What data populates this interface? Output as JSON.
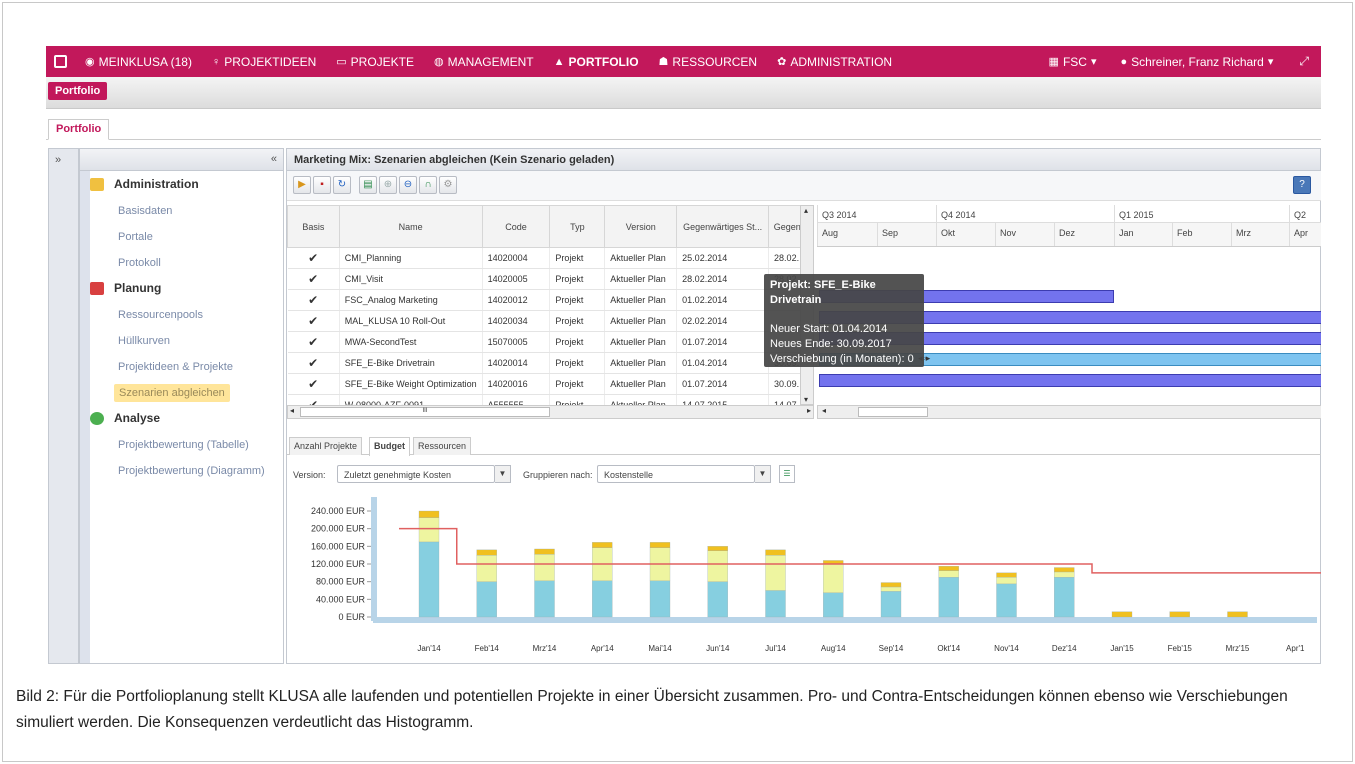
{
  "nav": {
    "items": [
      {
        "icon": "home-icon",
        "glyph": "◉",
        "label": "MEINKLUSA (18)"
      },
      {
        "icon": "lightbulb-icon",
        "glyph": "♀",
        "label": "PROJEKTIDEEN"
      },
      {
        "icon": "calendar-icon",
        "glyph": "▭",
        "label": "PROJEKTE"
      },
      {
        "icon": "globe-icon",
        "glyph": "◍",
        "label": "MANAGEMENT"
      },
      {
        "icon": "portfolio-icon",
        "glyph": "▲",
        "label": "PORTFOLIO",
        "active": true
      },
      {
        "icon": "people-icon",
        "glyph": "☗",
        "label": "RESSOURCEN"
      },
      {
        "icon": "gear-icon",
        "glyph": "✿",
        "label": "ADMINISTRATION"
      }
    ],
    "org": "FSC",
    "user": "Schreiner, Franz Richard",
    "color": "#c2185b"
  },
  "breadcrumb": "Portfolio",
  "tab": "Portfolio",
  "sidebar": {
    "sections": [
      {
        "label": "Administration",
        "color": "#f0c040",
        "items": [
          "Basisdaten",
          "Portale",
          "Protokoll"
        ]
      },
      {
        "label": "Planung",
        "color": "#d84040",
        "items": [
          "Ressourcenpools",
          "Hüllkurven",
          "Projektideen & Projekte",
          "Szenarien abgleichen"
        ]
      },
      {
        "label": "Analyse",
        "color": "#4caf50",
        "items": [
          "Projektbewertung (Tabelle)",
          "Projektbewertung (Diagramm)"
        ]
      }
    ],
    "selected": "Szenarien abgleichen"
  },
  "main": {
    "title": "Marketing Mix: Szenarien abgleichen (Kein Szenario geladen)",
    "grid": {
      "headers": [
        "Basis",
        "Name",
        "Code",
        "Typ",
        "Version",
        "Gegenwärtiges St...",
        "Gegenw"
      ],
      "rows": [
        [
          "✔",
          "CMI_Planning",
          "14020004",
          "Projekt",
          "Aktueller Plan",
          "25.02.2014",
          "28.02."
        ],
        [
          "✔",
          "CMI_Visit",
          "14020005",
          "Projekt",
          "Aktueller Plan",
          "28.02.2014",
          "28.02."
        ],
        [
          "✔",
          "FSC_Analog Marketing",
          "14020012",
          "Projekt",
          "Aktueller Plan",
          "01.02.2014",
          ""
        ],
        [
          "✔",
          "MAL_KLUSA 10 Roll-Out",
          "14020034",
          "Projekt",
          "Aktueller Plan",
          "02.02.2014",
          ""
        ],
        [
          "✔",
          "MWA-SecondTest",
          "15070005",
          "Projekt",
          "Aktueller Plan",
          "01.07.2014",
          ""
        ],
        [
          "✔",
          "SFE_E-Bike Drivetrain",
          "14020014",
          "Projekt",
          "Aktueller Plan",
          "01.04.2014",
          "30.09."
        ],
        [
          "✔",
          "SFE_E-Bike Weight Optimization",
          "14020016",
          "Projekt",
          "Aktueller Plan",
          "01.07.2014",
          "30.09."
        ],
        [
          "✔",
          "W-08000-AZF-0091",
          "A555555",
          "Projekt",
          "Aktueller Plan",
          "14.07.2015",
          "14.07."
        ]
      ],
      "scroll_marker": "III"
    },
    "gantt": {
      "quarters": [
        "Q3 2014",
        "Q4 2014",
        "Q1 2015",
        "Q2"
      ],
      "months": [
        "Aug",
        "Sep",
        "Okt",
        "Nov",
        "Dez",
        "Jan",
        "Feb",
        "Mrz",
        "Apr"
      ]
    },
    "tooltip": {
      "title": "Projekt: SFE_E-Bike Drivetrain",
      "start": "Neuer Start: 01.04.2014",
      "end": "Neues Ende: 30.09.2017",
      "shift": "Verschiebung (in Monaten): 0"
    },
    "bottom_tabs": [
      "Anzahl Projekte",
      "Budget",
      "Ressourcen"
    ],
    "active_bottom_tab": "Budget",
    "filters": {
      "version_label": "Version:",
      "version_value": "Zuletzt genehmigte Kosten",
      "group_label": "Gruppieren nach:",
      "group_value": "Kostenstelle"
    }
  },
  "chart_data": {
    "type": "bar",
    "stacked": true,
    "categories": [
      "Jan'14",
      "Feb'14",
      "Mrz'14",
      "Apr'14",
      "Mai'14",
      "Jun'14",
      "Jul'14",
      "Aug'14",
      "Sep'14",
      "Okt'14",
      "Nov'14",
      "Dez'14",
      "Jan'15",
      "Feb'15",
      "Mrz'15",
      "Apr'1"
    ],
    "series": [
      {
        "color": "#86cfe0",
        "values": [
          170000,
          80000,
          82000,
          82000,
          82000,
          80000,
          60000,
          55000,
          58000,
          90000,
          75000,
          90000,
          0,
          0,
          0,
          0
        ]
      },
      {
        "color": "#eef5a0",
        "values": [
          55000,
          60000,
          60000,
          75000,
          75000,
          70000,
          80000,
          65000,
          10000,
          15000,
          15000,
          12000,
          0,
          0,
          0,
          0
        ]
      },
      {
        "color": "#f0c020",
        "values": [
          15000,
          12000,
          12000,
          12000,
          12000,
          10000,
          12000,
          8000,
          10000,
          10000,
          10000,
          10000,
          12000,
          12000,
          12000,
          0
        ]
      }
    ],
    "capacity": {
      "color": "#e06060",
      "values": [
        200000,
        120000,
        120000,
        120000,
        120000,
        120000,
        120000,
        120000,
        120000,
        120000,
        120000,
        120000,
        100000,
        100000,
        100000,
        100000
      ]
    },
    "yticks": [
      "240.000 EUR",
      "200.000 EUR",
      "160.000 EUR",
      "120.000 EUR",
      "80.000 EUR",
      "40.000 EUR",
      "0 EUR"
    ],
    "ylim": [
      0,
      240000
    ],
    "grid": false
  },
  "caption": "Bild 2: Für die Portfolioplanung stellt KLUSA alle laufenden und potentiellen Projekte in einer Übersicht zusammen. Pro- und Contra-Entscheidungen können ebenso wie Verschiebungen simuliert werden. Die Konsequenzen verdeutlicht das Histogramm."
}
